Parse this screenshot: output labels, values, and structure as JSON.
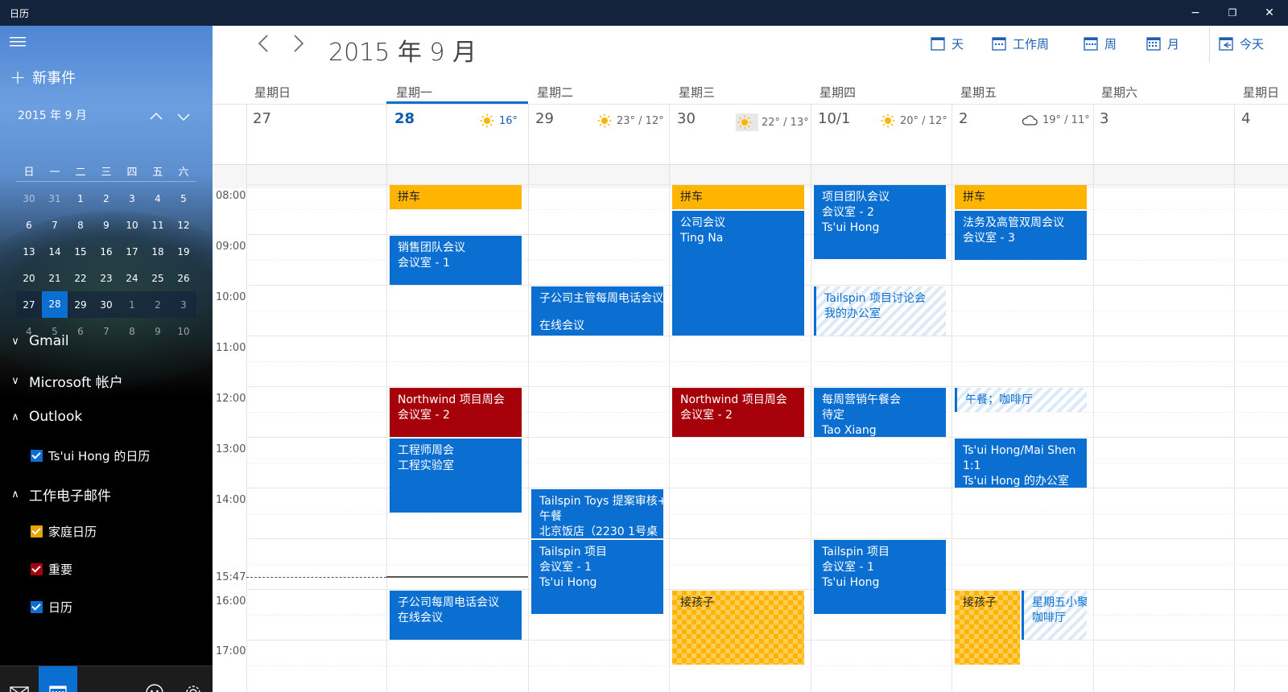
{
  "window": {
    "title": "日历",
    "minimize": "−",
    "restore": "❐",
    "close": "✕"
  },
  "sidebar": {
    "menu_icon": "hamburger-icon",
    "new_event": "新事件",
    "minical": {
      "title": "2015 年 9 月",
      "weekdays": [
        "日",
        "一",
        "二",
        "三",
        "四",
        "五",
        "六"
      ],
      "rows": [
        [
          "30",
          "31",
          "1",
          "2",
          "3",
          "4",
          "5"
        ],
        [
          "6",
          "7",
          "8",
          "9",
          "10",
          "11",
          "12"
        ],
        [
          "13",
          "14",
          "15",
          "16",
          "17",
          "18",
          "19"
        ],
        [
          "20",
          "21",
          "22",
          "23",
          "24",
          "25",
          "26"
        ],
        [
          "27",
          "28",
          "29",
          "30",
          "1",
          "2",
          "3"
        ],
        [
          "4",
          "5",
          "6",
          "7",
          "8",
          "9",
          "10"
        ]
      ]
    },
    "accounts": [
      {
        "name": "Gmail",
        "expanded": false
      },
      {
        "name": "Microsoft 帐户",
        "expanded": false
      },
      {
        "name": "Outlook",
        "expanded": true
      },
      {
        "name": "工作电子邮件",
        "expanded": true
      }
    ],
    "calendars": [
      {
        "name": "Ts'ui Hong 的日历",
        "color": "#0a6fd1"
      },
      {
        "name": "家庭日历",
        "color": "#e8a400"
      },
      {
        "name": "重要",
        "color": "#a6000b"
      },
      {
        "name": "日历",
        "color": "#0a6fd1"
      }
    ]
  },
  "header": {
    "month_title": "2015 年 9 月",
    "views": {
      "day": "天",
      "workweek": "工作周",
      "week": "周",
      "month": "月",
      "today": "今天"
    }
  },
  "days": [
    {
      "name": "星期日",
      "date": "27",
      "weather": ""
    },
    {
      "name": "星期一",
      "date": "28",
      "weather": "16°"
    },
    {
      "name": "星期二",
      "date": "29",
      "weather": "23° / 12°"
    },
    {
      "name": "星期三",
      "date": "30",
      "weather": "22° / 13°"
    },
    {
      "name": "星期四",
      "date": "10/1",
      "weather": "20° / 12°"
    },
    {
      "name": "星期五",
      "date": "2",
      "weather": "19° / 11°"
    },
    {
      "name": "星期六",
      "date": "3",
      "weather": ""
    },
    {
      "name": "星期日",
      "date": "4",
      "weather": ""
    }
  ],
  "times": [
    "08:00",
    "09:00",
    "10:00",
    "11:00",
    "12:00",
    "13:00",
    "14:00",
    "15:47",
    "16:00",
    "17:00"
  ],
  "events": {
    "mon_carpool": [
      "拼车"
    ],
    "mon_sales": [
      "销售团队会议",
      "会议室 - 1"
    ],
    "mon_northwind": [
      "Northwind 项目周会",
      "会议室 - 2"
    ],
    "mon_eng": [
      "工程师周会",
      "工程实验室"
    ],
    "mon_sub": [
      "子公司每周电话会议",
      "在线会议"
    ],
    "tue_sub": [
      "子公司主管每周电话会议",
      "",
      "在线会议"
    ],
    "tue_tailspin_toys": [
      "Tailspin Toys 提案审核+",
      "午餐",
      "北京饭店（2230 1号桌"
    ],
    "tue_tailspin": [
      "Tailspin 项目",
      "会议室 - 1",
      "Ts'ui Hong"
    ],
    "wed_carpool": [
      "拼车"
    ],
    "wed_company": [
      "公司会议",
      "Ting Na"
    ],
    "wed_northwind": [
      "Northwind 项目周会",
      "会议室 - 2"
    ],
    "wed_pickup": [
      "接孩子"
    ],
    "thu_team": [
      "项目团队会议",
      "会议室 - 2",
      "Ts'ui Hong"
    ],
    "thu_tailspin_disc": [
      "Tailspin 项目讨论会",
      "我的办公室"
    ],
    "thu_lunch": [
      "每周营销午餐会",
      "待定",
      "Tao Xiang"
    ],
    "thu_tailspin": [
      "Tailspin 项目",
      "会议室 - 1",
      "Ts'ui Hong"
    ],
    "fri_carpool": [
      "拼车"
    ],
    "fri_legal": [
      "法务及高管双周会议",
      "会议室 - 3"
    ],
    "fri_lunch": [
      "午餐；咖啡厅"
    ],
    "fri_oneonone": [
      "Ts'ui Hong/Mai Shen",
      "1:1",
      "Ts'ui Hong 的办公室"
    ],
    "fri_pickup": [
      "接孩子"
    ],
    "fri_party": [
      "星期五小聚",
      "咖啡厅"
    ]
  }
}
